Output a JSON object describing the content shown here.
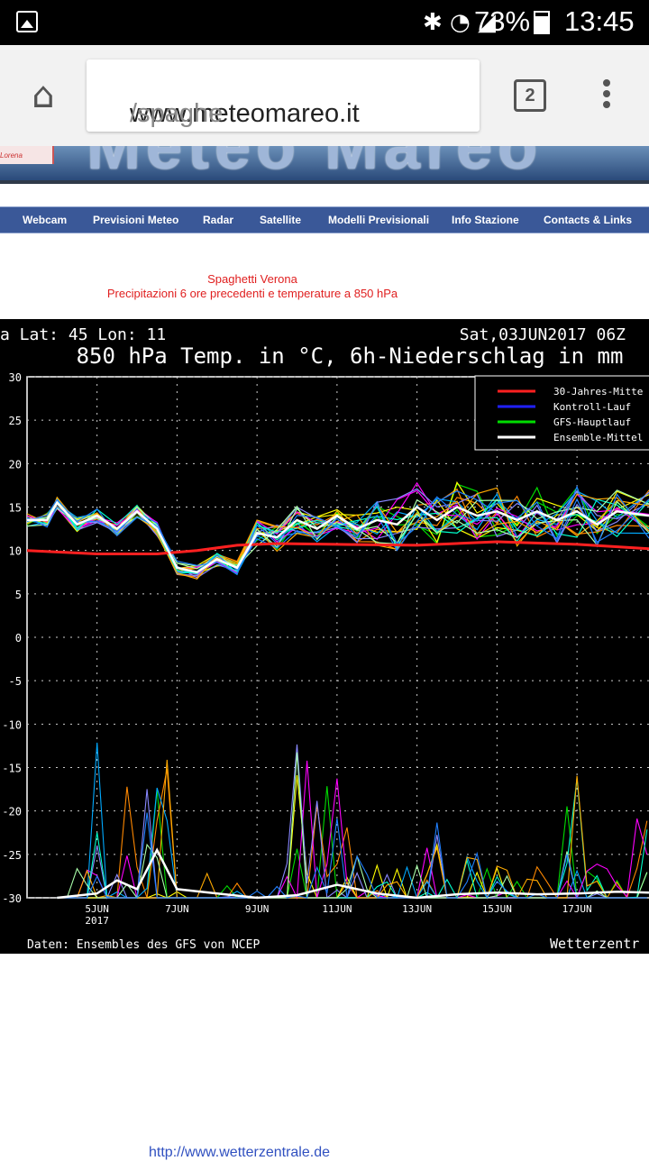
{
  "status_bar": {
    "battery": "73%",
    "time": "13:45",
    "icons": [
      "bluetooth-icon",
      "wifi-icon",
      "signal-icon",
      "battery-icon"
    ]
  },
  "browser": {
    "url_domain": "www.meteomareo.it",
    "url_path": "/spaghe",
    "tab_count": "2"
  },
  "banner": {
    "logo_text": "Meteo Mareo",
    "thumb_text": "Lorena"
  },
  "nav": {
    "items": [
      "Webcam",
      "Previsioni Meteo",
      "Radar",
      "Satellite",
      "Modelli Previsionali",
      "Info Stazione",
      "Contacts & Links"
    ]
  },
  "page": {
    "title_line1": "Spaghetti Verona",
    "title_line2": "Precipitazioni 6 ore precedenti e temperature a 850 hPa",
    "bottom_link": "http://www.wetterzentrale.de"
  },
  "chart_header": {
    "location": "a   Lat: 45 Lon: 11",
    "date": "Sat,03JUN2017 06Z",
    "title": "850 hPa Temp. in °C, 6h-Niederschlag in mm",
    "footer_left": "Daten: Ensembles des GFS von NCEP",
    "footer_right": "Wetterzentr"
  },
  "chart_data": {
    "type": "line",
    "title": "850 hPa Temp. in °C, 6h-Niederschlag in mm",
    "ylim": [
      -30,
      30
    ],
    "yticks": [
      "30",
      "25",
      "20",
      "15",
      "10",
      "5",
      "0",
      "-5",
      "-10",
      "-15",
      "-20",
      "-25",
      "-30"
    ],
    "xticks": [
      "5JUN\n2017",
      "7JUN",
      "9JUN",
      "11JUN",
      "13JUN",
      "15JUN",
      "17JUN"
    ],
    "xtick_days": [
      5,
      7,
      9,
      11,
      13,
      15,
      17
    ],
    "x_range_days": [
      3.25,
      18.8
    ],
    "legend": [
      {
        "name": "30-Jahres-Mitte",
        "color": "#ff2020"
      },
      {
        "name": "Kontroll-Lauf",
        "color": "#2020ff"
      },
      {
        "name": "GFS-Hauptlauf",
        "color": "#00dd00"
      },
      {
        "name": "Ensemble-Mittel",
        "color": "#ffffff"
      }
    ],
    "climate_mean": {
      "x": [
        3.25,
        5,
        6.5,
        7.5,
        8.5,
        9.5,
        11,
        13,
        15,
        17,
        18.8
      ],
      "y": [
        10,
        9.6,
        9.6,
        10,
        10.6,
        10.8,
        10.7,
        10.6,
        11,
        10.7,
        10.2
      ]
    },
    "ensemble_mean_temp": {
      "x": [
        3.25,
        3.75,
        4,
        4.5,
        5,
        5.5,
        6,
        6.5,
        7,
        7.5,
        8,
        8.5,
        9,
        9.5,
        10,
        10.5,
        11,
        11.5,
        12,
        12.5,
        13,
        13.5,
        14,
        14.5,
        15,
        15.5,
        16,
        16.5,
        17,
        17.5,
        18,
        18.8
      ],
      "y": [
        13.5,
        13.5,
        15.5,
        13,
        14,
        12.5,
        14.5,
        12.5,
        8,
        7.5,
        9,
        8,
        12,
        11.5,
        13.5,
        12.5,
        14,
        12.5,
        13.5,
        13,
        15,
        13.5,
        15,
        14,
        14.5,
        13.5,
        14.5,
        13.5,
        14.5,
        13,
        14.5,
        14
      ]
    },
    "ensemble_mean_precip": {
      "x": [
        4,
        5,
        5.5,
        6,
        6.5,
        7,
        9,
        10,
        11,
        12,
        13,
        14,
        15,
        16,
        17,
        18,
        18.8
      ],
      "y": [
        0,
        0.5,
        2,
        1,
        5.5,
        1,
        0,
        0.3,
        1.5,
        0.5,
        0,
        0.4,
        0.6,
        0.4,
        0.5,
        0.7,
        0.6
      ]
    },
    "series_colors": [
      "#00dd00",
      "#ff8800",
      "#ffff00",
      "#00aaff",
      "#ff00ff",
      "#8888ff",
      "#00ffcc",
      "#ffaa00",
      "#aaffaa",
      "#2080ff"
    ]
  }
}
